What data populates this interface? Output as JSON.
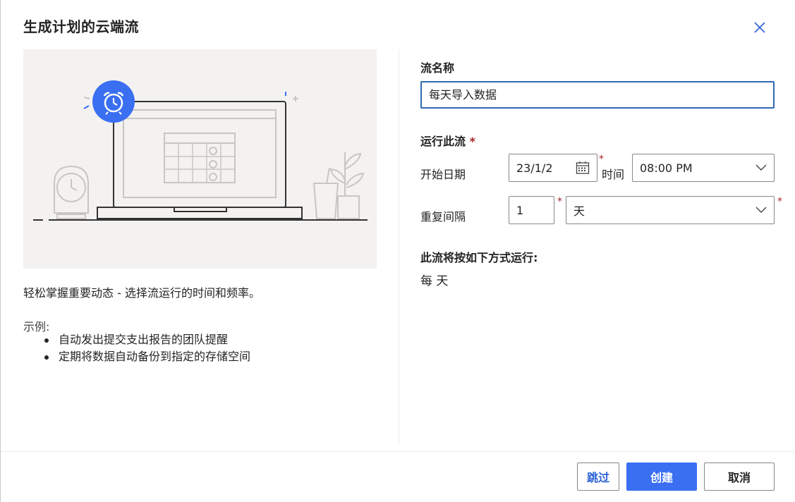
{
  "dialog": {
    "title": "生成计划的云端流"
  },
  "left": {
    "description": "轻松掌握重要动态 - 选择流运行的时间和频率。",
    "example_label": "示例:",
    "examples": [
      "自动发出提交支出报告的团队提醒",
      "定期将数据自动备份到指定的存储空间"
    ]
  },
  "form": {
    "flow_name_label": "流名称",
    "flow_name_value": "每天导入数据",
    "run_label": "运行此流",
    "required_mark": "*",
    "start_date_label": "开始日期",
    "start_date_value": "23/1/2",
    "time_label": "时间",
    "time_value": "08:00 PM",
    "repeat_label": "重复间隔",
    "repeat_count": "1",
    "repeat_unit": "天",
    "summary_label": "此流将按如下方式运行:",
    "summary_value": "每 天"
  },
  "footer": {
    "skip": "跳过",
    "create": "创建",
    "cancel": "取消"
  },
  "colors": {
    "accent": "#3a6ff2",
    "focus_border": "#2f6ab4",
    "required": "#a4262c"
  },
  "icons": {
    "close": "close-icon",
    "calendar": "calendar-icon",
    "dropdown": "chevron-down-icon",
    "alarm": "alarm-clock-icon"
  }
}
